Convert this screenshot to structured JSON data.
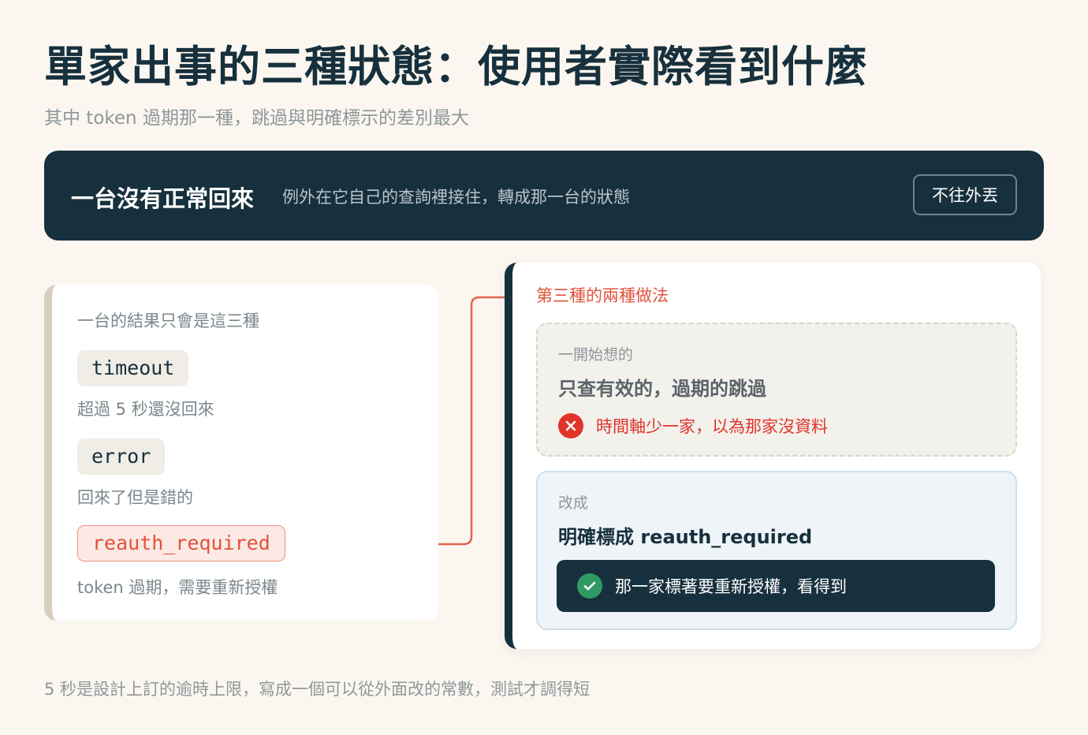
{
  "header": {
    "title": "單家出事的三種狀態：使用者實際看到什麼",
    "subtitle": "其中 token 過期那一種，跳過與明確標示的差別最大"
  },
  "banner": {
    "title": "一台沒有正常回來",
    "description": "例外在它自己的查詢裡接住，轉成那一台的狀態",
    "button_label": "不往外丟"
  },
  "result_states": {
    "heading": "一台的結果只會是這三種",
    "items": [
      {
        "code": "timeout",
        "description": "超過 5 秒還沒回來"
      },
      {
        "code": "error",
        "description": "回來了但是錯的"
      },
      {
        "code": "reauth_required",
        "description": "token 過期，需要重新授權",
        "highlight": true
      }
    ]
  },
  "approaches": {
    "heading": "第三種的兩種做法",
    "initial": {
      "label": "一開始想的",
      "title": "只查有效的，過期的跳過",
      "consequence": "時間軸少一家，以為那家沒資料",
      "icon": "x-icon"
    },
    "revised": {
      "label": "改成",
      "title": "明確標成 reauth_required",
      "consequence": "那一家標著要重新授權，看得到",
      "icon": "check-icon"
    }
  },
  "footer": {
    "note": "5 秒是設計上訂的逾時上限，寫成一個可以從外面改的常數，測試才調得短"
  },
  "colors": {
    "navy": "#17303d",
    "accent_red": "#e0533b",
    "error_red": "#e0342a",
    "success_green": "#2f9a64",
    "background": "#fbf7f0"
  }
}
